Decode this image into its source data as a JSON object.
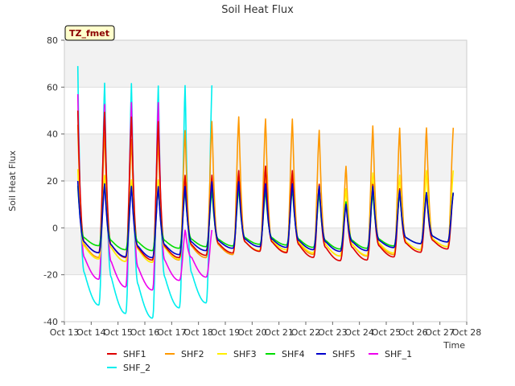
{
  "chart_data": {
    "type": "line",
    "title": "Soil Heat Flux",
    "xlabel": "Time",
    "ylabel": "Soil Heat Flux",
    "badge": "TZ_fmet",
    "xlim": [
      13,
      28
    ],
    "ylim": [
      -40,
      80
    ],
    "x_ticks": [
      {
        "value": 13,
        "label": "Oct 13"
      },
      {
        "value": 14,
        "label": "Oct 14"
      },
      {
        "value": 15,
        "label": "Oct 15"
      },
      {
        "value": 16,
        "label": "Oct 16"
      },
      {
        "value": 17,
        "label": "Oct 17"
      },
      {
        "value": 18,
        "label": "Oct 18"
      },
      {
        "value": 19,
        "label": "Oct 19"
      },
      {
        "value": 20,
        "label": "Oct 20"
      },
      {
        "value": 21,
        "label": "Oct 21"
      },
      {
        "value": 22,
        "label": "Oct 22"
      },
      {
        "value": 23,
        "label": "Oct 23"
      },
      {
        "value": 24,
        "label": "Oct 24"
      },
      {
        "value": 25,
        "label": "Oct 25"
      },
      {
        "value": 26,
        "label": "Oct 26"
      },
      {
        "value": 27,
        "label": "Oct 27"
      },
      {
        "value": 28,
        "label": "Oct 28"
      }
    ],
    "y_ticks": [
      -40,
      -20,
      0,
      20,
      40,
      60,
      80
    ],
    "grid": "horizontal bands",
    "legend_position": "bottom",
    "x_unit": "day of October",
    "series": [
      {
        "name": "SHF1",
        "color": "#dd0000",
        "min": [
          -10,
          -12,
          -14,
          -13,
          -12,
          -11,
          -10,
          -10,
          -12,
          -14,
          -14,
          -13,
          -11,
          -9
        ],
        "max": [
          50,
          52,
          50,
          48,
          24,
          24,
          26,
          28,
          26,
          20,
          12,
          20,
          18,
          16
        ]
      },
      {
        "name": "SHF2",
        "color": "#ff9900",
        "min": [
          -12,
          -14,
          -15,
          -14,
          -13,
          -12,
          -10,
          -10,
          -11,
          -12,
          -12,
          -12,
          -10,
          -8
        ],
        "max": [
          44,
          43,
          40,
          40,
          44,
          48,
          50,
          49,
          49,
          44,
          28,
          46,
          45,
          45
        ]
      },
      {
        "name": "SHF3",
        "color": "#ffee00",
        "min": [
          -13,
          -14,
          -15,
          -14,
          -12,
          -11,
          -10,
          -9,
          -10,
          -12,
          -12,
          -11,
          -10,
          -8
        ],
        "max": [
          25,
          24,
          22,
          22,
          22,
          23,
          25,
          24,
          25,
          20,
          18,
          25,
          24,
          26
        ]
      },
      {
        "name": "SHF4",
        "color": "#00dd00",
        "min": [
          -7,
          -9,
          -10,
          -9,
          -8,
          -8,
          -7,
          -7,
          -8,
          -9,
          -9,
          -8,
          -7,
          -6
        ],
        "max": [
          18,
          20,
          19,
          18,
          17,
          17,
          18,
          17,
          18,
          16,
          12,
          16,
          16,
          16
        ]
      },
      {
        "name": "SHF5",
        "color": "#0000cc",
        "min": [
          -10,
          -12,
          -13,
          -12,
          -10,
          -9,
          -8,
          -8,
          -9,
          -10,
          -10,
          -9,
          -7,
          -6
        ],
        "max": [
          20,
          20,
          19,
          19,
          19,
          21,
          21,
          20,
          20,
          19,
          11,
          19,
          17,
          16
        ]
      },
      {
        "name": "SHF_1",
        "color": "#ee00ee",
        "min": [
          -21,
          -24,
          -28,
          -23,
          -21
        ],
        "max": [
          57,
          56,
          57,
          57,
          0
        ]
      },
      {
        "name": "SHF_2",
        "color": "#00eeee",
        "min": [
          -32,
          -35,
          -40,
          -35,
          -32
        ],
        "max": [
          69,
          66,
          66,
          65,
          65
        ]
      }
    ]
  }
}
